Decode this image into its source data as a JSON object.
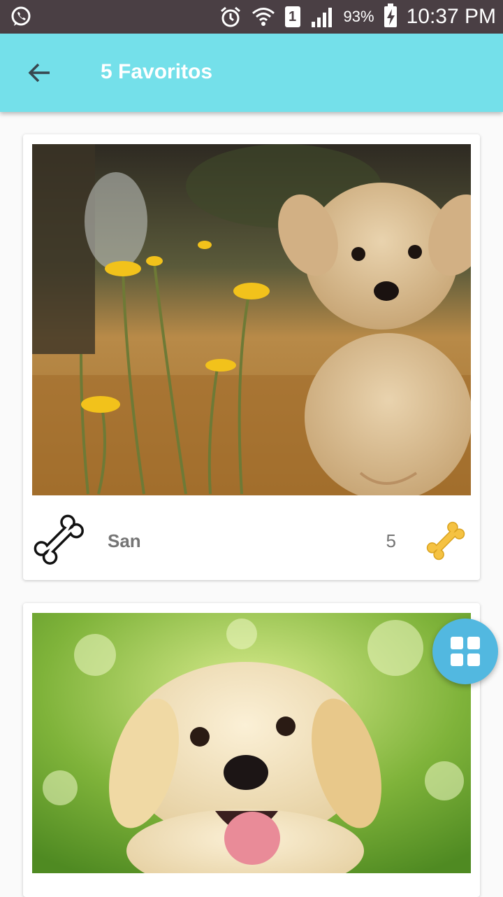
{
  "status_bar": {
    "battery_percent": "93%",
    "time": "10:37 PM",
    "sim_slot": "1",
    "icons": [
      "whatsapp-icon",
      "alarm-icon",
      "wifi-icon",
      "sim-icon",
      "signal-icon",
      "battery-charging-icon"
    ]
  },
  "app_bar": {
    "title": "5 Favoritos",
    "back_icon": "arrow-back-icon",
    "background": "#74e0ea"
  },
  "favorites": [
    {
      "name": "San",
      "likes": "5",
      "photo": "fluffy puppy among yellow flowers"
    },
    {
      "name": "",
      "likes": "",
      "photo": "labrador puppy on green background"
    }
  ],
  "fab": {
    "icon": "grid-view-icon",
    "color": "#52b8e0"
  }
}
